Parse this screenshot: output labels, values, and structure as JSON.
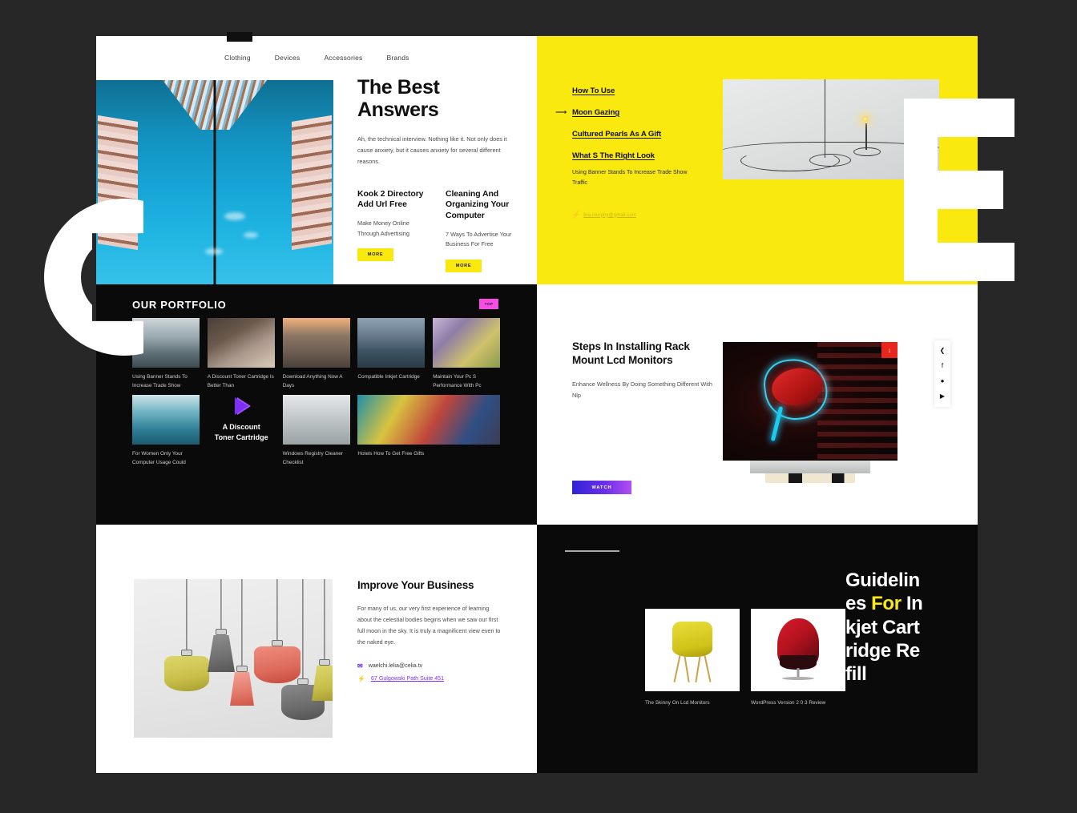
{
  "nav": {
    "items": [
      "Clothing",
      "Devices",
      "Accessories",
      "Brands"
    ]
  },
  "hero": {
    "title_line1": "The Best",
    "title_line2": "Answers",
    "body": "Ah, the technical interview. Nothing like it. Not only does it cause anxiety, but it causes anxiety for several different reasons.",
    "cards": [
      {
        "title": "Kook 2 Directory Add Url Free",
        "subtitle": "Make Money Online Through Advertising",
        "button": "MORE"
      },
      {
        "title": "Cleaning And Organizing Your Computer",
        "subtitle": "7 Ways To Advertise Your Business For Free",
        "button": "MORE"
      }
    ]
  },
  "yellow_panel": {
    "links": [
      {
        "label": "How To Use",
        "active": false
      },
      {
        "label": "Moon Gazing",
        "active": true
      },
      {
        "label": "Cultured Pearls As A Gift",
        "active": false
      },
      {
        "label": "What S The Right Look",
        "active": false
      }
    ],
    "caption": "Using Banner Stands To Increase Trade Show Traffic",
    "email": "bra.murphy@gmail.com",
    "email_icon": "bolt-icon",
    "background_color": "#fae90f"
  },
  "portfolio": {
    "heading": "OUR PORTFOLIO",
    "top_badge": "TOP",
    "top_badge_color": "#f54ee1",
    "items": [
      {
        "caption": "Using Banner Stands To Increase Trade Show"
      },
      {
        "caption": "A Discount Toner Cartridge Is Better Than"
      },
      {
        "caption": "Download Anything Now A Days"
      },
      {
        "caption": "Compatible Inkjet Cartridge"
      },
      {
        "caption": "Maintain Your Pc S Performance With Pc"
      },
      {
        "caption": "For Women Only Your Computer Usage Could"
      },
      {
        "caption": "Windows Registry Cleaner Checklist"
      },
      {
        "caption": "Hotels How To Get Free Gifts"
      }
    ],
    "promo": {
      "line1": "A Discount",
      "line2": "Toner Cartridge",
      "icon": "play-icon"
    }
  },
  "steps": {
    "title": "Steps In Installing Rack Mount Lcd Monitors",
    "body": "Enhance Wellness By Doing Something Different With Nlp",
    "button": "WATCH",
    "download_icon": "download-arrow-icon",
    "social_icons": [
      "share-icon",
      "facebook-icon",
      "twitter-icon",
      "youtube-icon"
    ]
  },
  "improve": {
    "title": "Improve Your Business",
    "body": "For many of us, our very first experience of learning about the celestial bodies begins when we saw our first full moon in the sky. It is truly a magnificent view even to the naked eye.",
    "email": "waelchi.lelia@celia.tv",
    "email_icon": "mail-icon",
    "address": "67 Gulgowski Path Suite 451",
    "address_icon": "bolt-icon"
  },
  "guidelines": {
    "title_part1": "Guidelines ",
    "title_highlight": "For",
    "title_part2": " Inkjet Cartridge Refill",
    "highlight_color": "#fae90f",
    "cards": [
      {
        "caption": "The Skinny On Lcd Monitors"
      },
      {
        "caption": "WordPress Version 2 0 3 Review"
      }
    ]
  }
}
